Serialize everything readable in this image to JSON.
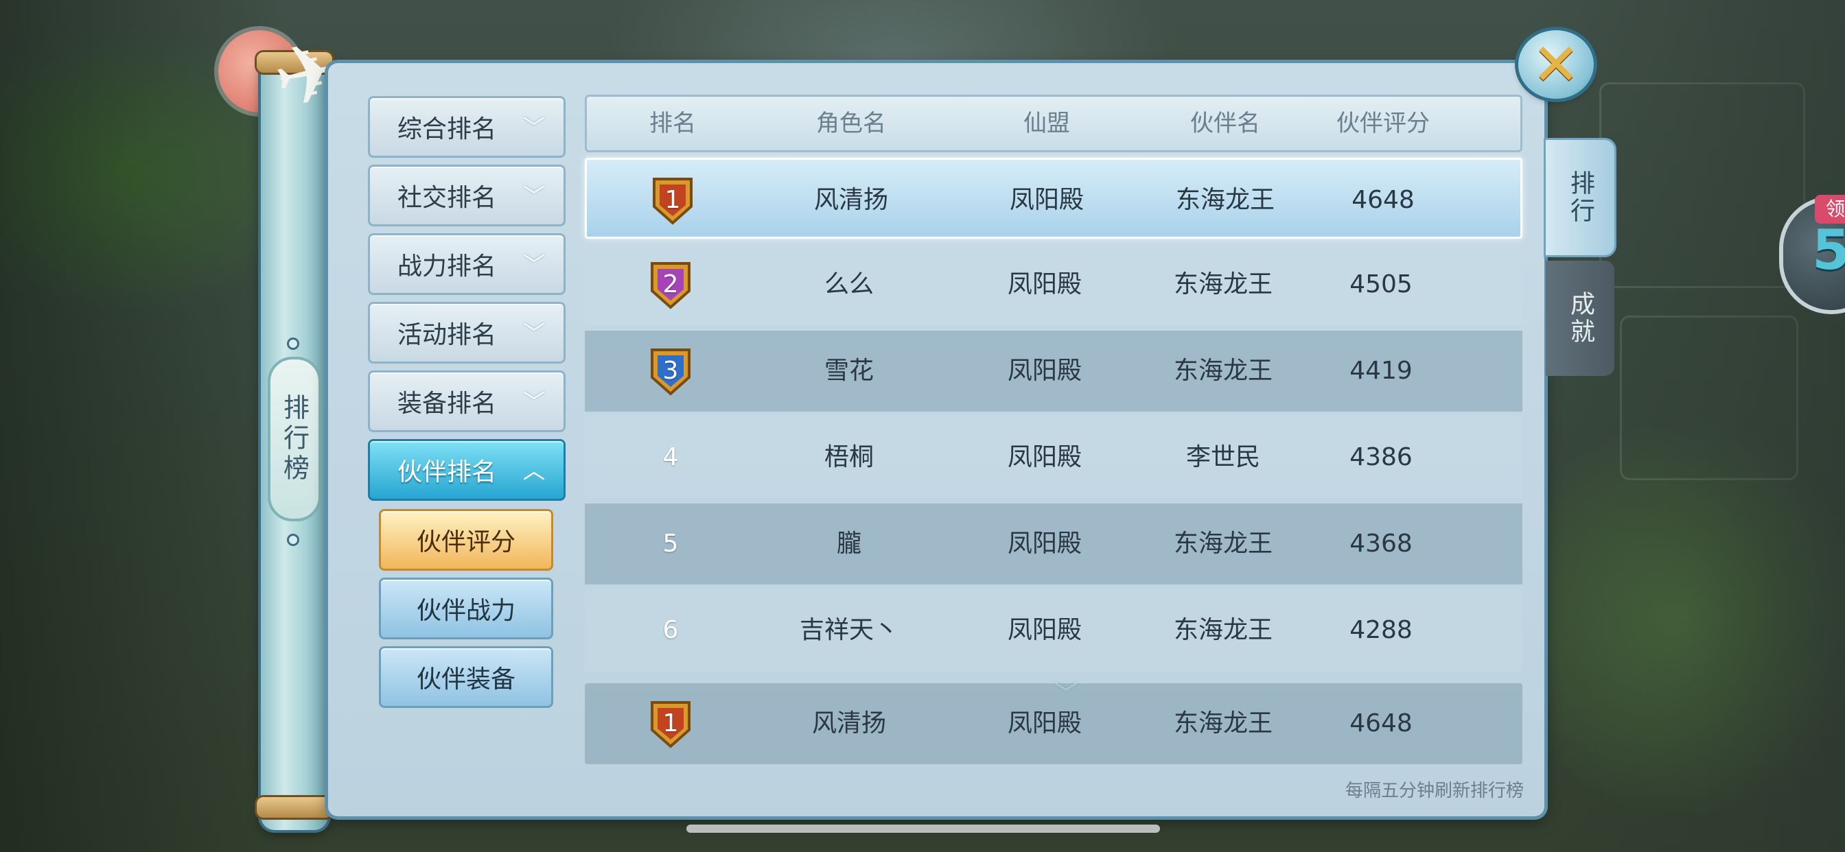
{
  "scroll": {
    "label": "排行榜"
  },
  "close_icon": "close-icon",
  "categories": [
    {
      "label": "综合排名",
      "expanded": false
    },
    {
      "label": "社交排名",
      "expanded": false
    },
    {
      "label": "战力排名",
      "expanded": false
    },
    {
      "label": "活动排名",
      "expanded": false
    },
    {
      "label": "装备排名",
      "expanded": false
    },
    {
      "label": "伙伴排名",
      "expanded": true
    }
  ],
  "subcategories": [
    {
      "label": "伙伴评分",
      "selected": true
    },
    {
      "label": "伙伴战力",
      "selected": false
    },
    {
      "label": "伙伴装备",
      "selected": false
    }
  ],
  "table": {
    "headers": [
      "排名",
      "角色名",
      "仙盟",
      "伙伴名",
      "伙伴评分"
    ],
    "rows": [
      {
        "rank": "1",
        "name": "风清扬",
        "guild": "凤阳殿",
        "partner": "东海龙王",
        "score": "4648"
      },
      {
        "rank": "2",
        "name": "么么",
        "guild": "凤阳殿",
        "partner": "东海龙王",
        "score": "4505"
      },
      {
        "rank": "3",
        "name": "雪花",
        "guild": "凤阳殿",
        "partner": "东海龙王",
        "score": "4419"
      },
      {
        "rank": "4",
        "name": "梧桐",
        "guild": "凤阳殿",
        "partner": "李世民",
        "score": "4386"
      },
      {
        "rank": "5",
        "name": "朧",
        "guild": "凤阳殿",
        "partner": "东海龙王",
        "score": "4368"
      },
      {
        "rank": "6",
        "name": "吉祥天丶",
        "guild": "凤阳殿",
        "partner": "东海龙王",
        "score": "4288"
      }
    ],
    "my_row": {
      "rank": "1",
      "name": "风清扬",
      "guild": "凤阳殿",
      "partner": "东海龙王",
      "score": "4648"
    }
  },
  "footer_note": "每隔五分钟刷新排行榜",
  "right_tabs": [
    {
      "label": "排行",
      "active": true
    },
    {
      "label": "成就",
      "active": false
    }
  ],
  "reward": {
    "tag": "领",
    "number": "5"
  },
  "colors": {
    "gold_badge": "#d9992c",
    "purple_badge": "#a544b8",
    "blue_badge": "#2f6fc8",
    "active_category": "#27a6d2",
    "active_subcategory": "#f1b65b"
  }
}
